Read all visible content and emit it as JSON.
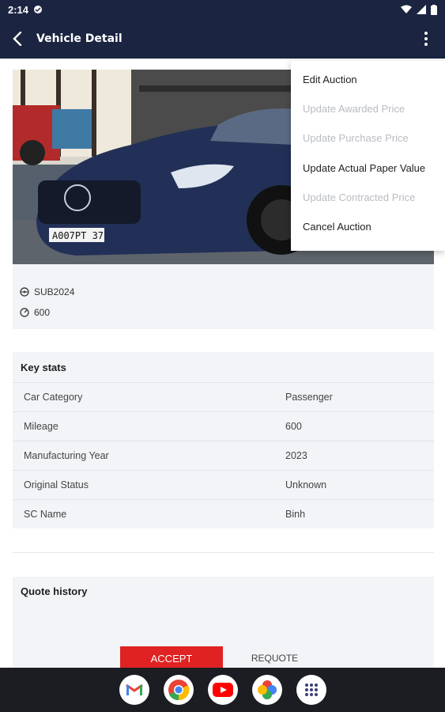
{
  "status_bar": {
    "time": "2:14"
  },
  "app_bar": {
    "title": "Vehicle Detail"
  },
  "photo": {
    "plate": "A007PT 37"
  },
  "vehicle": {
    "code": "SUB2024",
    "mileage": "600"
  },
  "key_stats": {
    "title": "Key stats",
    "rows": [
      {
        "label": "Car Category",
        "value": "Passenger"
      },
      {
        "label": "Mileage",
        "value": "600"
      },
      {
        "label": "Manufacturing Year",
        "value": "2023"
      },
      {
        "label": "Original Status",
        "value": "Unknown"
      },
      {
        "label": "SC Name",
        "value": "Binh"
      }
    ]
  },
  "quote_history": {
    "title": "Quote history",
    "accept_label": "ACCEPT",
    "requote_label": "REQUOTE"
  },
  "menu": {
    "items": [
      {
        "label": "Edit Auction",
        "enabled": true
      },
      {
        "label": "Update Awarded Price",
        "enabled": false
      },
      {
        "label": "Update Purchase Price",
        "enabled": false
      },
      {
        "label": "Update Actual Paper Value",
        "enabled": true
      },
      {
        "label": "Update Contracted Price",
        "enabled": false
      },
      {
        "label": "Cancel Auction",
        "enabled": true
      }
    ]
  },
  "dock": {
    "apps": [
      "gmail-icon",
      "chrome-icon",
      "youtube-icon",
      "photos-icon",
      "app-drawer-icon"
    ]
  },
  "colors": {
    "app_bar": "#1b2440",
    "accent": "#e02222",
    "card": "#f2f4f7"
  }
}
